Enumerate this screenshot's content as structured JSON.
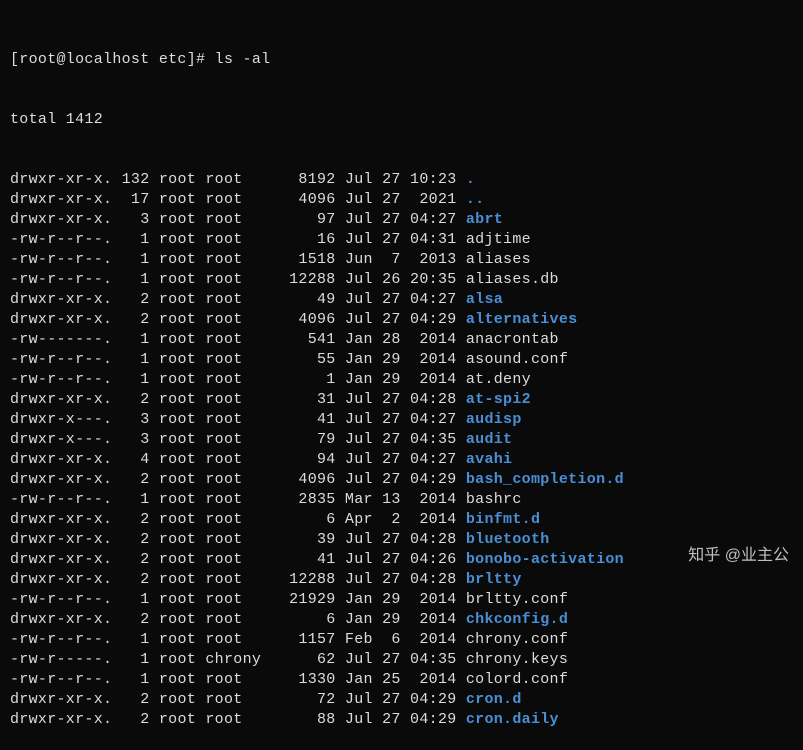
{
  "prompt": {
    "user_host": "[root@localhost etc]#",
    "command": "ls -al"
  },
  "total_line": "total 1412",
  "rows": [
    {
      "perm": "drwxr-xr-x.",
      "links": "132",
      "user": "root",
      "group": "root",
      "size": "8192",
      "month": "Jul",
      "day": "27",
      "time": "10:23",
      "name": ".",
      "type": "dir"
    },
    {
      "perm": "drwxr-xr-x.",
      "links": "17",
      "user": "root",
      "group": "root",
      "size": "4096",
      "month": "Jul",
      "day": "27",
      "time": "2021",
      "name": "..",
      "type": "dir"
    },
    {
      "perm": "drwxr-xr-x.",
      "links": "3",
      "user": "root",
      "group": "root",
      "size": "97",
      "month": "Jul",
      "day": "27",
      "time": "04:27",
      "name": "abrt",
      "type": "dir"
    },
    {
      "perm": "-rw-r--r--.",
      "links": "1",
      "user": "root",
      "group": "root",
      "size": "16",
      "month": "Jul",
      "day": "27",
      "time": "04:31",
      "name": "adjtime",
      "type": "file"
    },
    {
      "perm": "-rw-r--r--.",
      "links": "1",
      "user": "root",
      "group": "root",
      "size": "1518",
      "month": "Jun",
      "day": "7",
      "time": "2013",
      "name": "aliases",
      "type": "file"
    },
    {
      "perm": "-rw-r--r--.",
      "links": "1",
      "user": "root",
      "group": "root",
      "size": "12288",
      "month": "Jul",
      "day": "26",
      "time": "20:35",
      "name": "aliases.db",
      "type": "file"
    },
    {
      "perm": "drwxr-xr-x.",
      "links": "2",
      "user": "root",
      "group": "root",
      "size": "49",
      "month": "Jul",
      "day": "27",
      "time": "04:27",
      "name": "alsa",
      "type": "dir"
    },
    {
      "perm": "drwxr-xr-x.",
      "links": "2",
      "user": "root",
      "group": "root",
      "size": "4096",
      "month": "Jul",
      "day": "27",
      "time": "04:29",
      "name": "alternatives",
      "type": "dir"
    },
    {
      "perm": "-rw-------.",
      "links": "1",
      "user": "root",
      "group": "root",
      "size": "541",
      "month": "Jan",
      "day": "28",
      "time": "2014",
      "name": "anacrontab",
      "type": "file"
    },
    {
      "perm": "-rw-r--r--.",
      "links": "1",
      "user": "root",
      "group": "root",
      "size": "55",
      "month": "Jan",
      "day": "29",
      "time": "2014",
      "name": "asound.conf",
      "type": "file"
    },
    {
      "perm": "-rw-r--r--.",
      "links": "1",
      "user": "root",
      "group": "root",
      "size": "1",
      "month": "Jan",
      "day": "29",
      "time": "2014",
      "name": "at.deny",
      "type": "file"
    },
    {
      "perm": "drwxr-xr-x.",
      "links": "2",
      "user": "root",
      "group": "root",
      "size": "31",
      "month": "Jul",
      "day": "27",
      "time": "04:28",
      "name": "at-spi2",
      "type": "dir"
    },
    {
      "perm": "drwxr-x---.",
      "links": "3",
      "user": "root",
      "group": "root",
      "size": "41",
      "month": "Jul",
      "day": "27",
      "time": "04:27",
      "name": "audisp",
      "type": "dir"
    },
    {
      "perm": "drwxr-x---.",
      "links": "3",
      "user": "root",
      "group": "root",
      "size": "79",
      "month": "Jul",
      "day": "27",
      "time": "04:35",
      "name": "audit",
      "type": "dir"
    },
    {
      "perm": "drwxr-xr-x.",
      "links": "4",
      "user": "root",
      "group": "root",
      "size": "94",
      "month": "Jul",
      "day": "27",
      "time": "04:27",
      "name": "avahi",
      "type": "dir"
    },
    {
      "perm": "drwxr-xr-x.",
      "links": "2",
      "user": "root",
      "group": "root",
      "size": "4096",
      "month": "Jul",
      "day": "27",
      "time": "04:29",
      "name": "bash_completion.d",
      "type": "dir"
    },
    {
      "perm": "-rw-r--r--.",
      "links": "1",
      "user": "root",
      "group": "root",
      "size": "2835",
      "month": "Mar",
      "day": "13",
      "time": "2014",
      "name": "bashrc",
      "type": "file"
    },
    {
      "perm": "drwxr-xr-x.",
      "links": "2",
      "user": "root",
      "group": "root",
      "size": "6",
      "month": "Apr",
      "day": "2",
      "time": "2014",
      "name": "binfmt.d",
      "type": "dir"
    },
    {
      "perm": "drwxr-xr-x.",
      "links": "2",
      "user": "root",
      "group": "root",
      "size": "39",
      "month": "Jul",
      "day": "27",
      "time": "04:28",
      "name": "bluetooth",
      "type": "dir"
    },
    {
      "perm": "drwxr-xr-x.",
      "links": "2",
      "user": "root",
      "group": "root",
      "size": "41",
      "month": "Jul",
      "day": "27",
      "time": "04:26",
      "name": "bonobo-activation",
      "type": "dir"
    },
    {
      "perm": "drwxr-xr-x.",
      "links": "2",
      "user": "root",
      "group": "root",
      "size": "12288",
      "month": "Jul",
      "day": "27",
      "time": "04:28",
      "name": "brltty",
      "type": "dir"
    },
    {
      "perm": "-rw-r--r--.",
      "links": "1",
      "user": "root",
      "group": "root",
      "size": "21929",
      "month": "Jan",
      "day": "29",
      "time": "2014",
      "name": "brltty.conf",
      "type": "file"
    },
    {
      "perm": "drwxr-xr-x.",
      "links": "2",
      "user": "root",
      "group": "root",
      "size": "6",
      "month": "Jan",
      "day": "29",
      "time": "2014",
      "name": "chkconfig.d",
      "type": "dir"
    },
    {
      "perm": "-rw-r--r--.",
      "links": "1",
      "user": "root",
      "group": "root",
      "size": "1157",
      "month": "Feb",
      "day": "6",
      "time": "2014",
      "name": "chrony.conf",
      "type": "file"
    },
    {
      "perm": "-rw-r-----.",
      "links": "1",
      "user": "root",
      "group": "chrony",
      "size": "62",
      "month": "Jul",
      "day": "27",
      "time": "04:35",
      "name": "chrony.keys",
      "type": "file"
    },
    {
      "perm": "-rw-r--r--.",
      "links": "1",
      "user": "root",
      "group": "root",
      "size": "1330",
      "month": "Jan",
      "day": "25",
      "time": "2014",
      "name": "colord.conf",
      "type": "file"
    },
    {
      "perm": "drwxr-xr-x.",
      "links": "2",
      "user": "root",
      "group": "root",
      "size": "72",
      "month": "Jul",
      "day": "27",
      "time": "04:29",
      "name": "cron.d",
      "type": "dir"
    },
    {
      "perm": "drwxr-xr-x.",
      "links": "2",
      "user": "root",
      "group": "root",
      "size": "88",
      "month": "Jul",
      "day": "27",
      "time": "04:29",
      "name": "cron.daily",
      "type": "dir"
    }
  ],
  "watermark": "知乎 @业主公"
}
